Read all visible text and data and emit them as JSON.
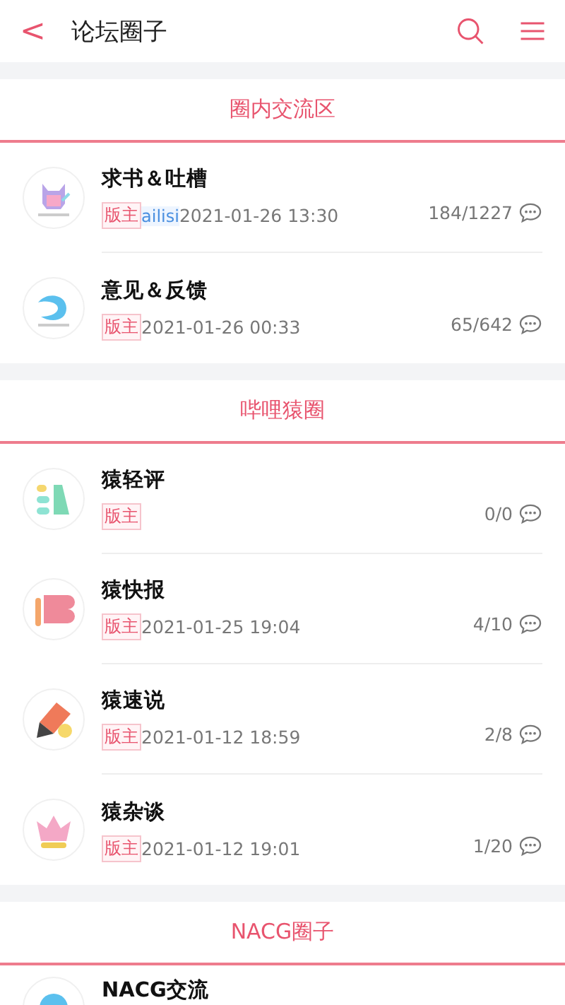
{
  "header": {
    "back": "<",
    "title": "论坛圈子"
  },
  "sections": [
    {
      "title": "圈内交流区",
      "forums": [
        {
          "kind": "cat",
          "name": "求书＆吐槽",
          "badge": "版主",
          "moderator": "ailisi",
          "date": "2021-01-26 13:30",
          "count": "184/1227"
        },
        {
          "kind": "wave",
          "name": "意见＆反馈",
          "badge": "版主",
          "date": "2021-01-26 00:33",
          "count": "65/642"
        }
      ]
    },
    {
      "title": "哔哩猿圈",
      "forums": [
        {
          "kind": "blocks",
          "name": "猿轻评",
          "badge": "版主",
          "count": "0/0"
        },
        {
          "kind": "flag",
          "name": "猿快报",
          "badge": "版主",
          "date": "2021-01-25 19:04",
          "count": "4/10"
        },
        {
          "kind": "pencil",
          "name": "猿速说",
          "badge": "版主",
          "date": "2021-01-12 18:59",
          "count": "2/8"
        },
        {
          "kind": "crown",
          "name": "猿杂谈",
          "badge": "版主",
          "date": "2021-01-12 19:01",
          "count": "1/20"
        }
      ]
    },
    {
      "title": "NACG圈子",
      "forums": [
        {
          "kind": "globe",
          "name": "NACG交流"
        }
      ]
    }
  ]
}
